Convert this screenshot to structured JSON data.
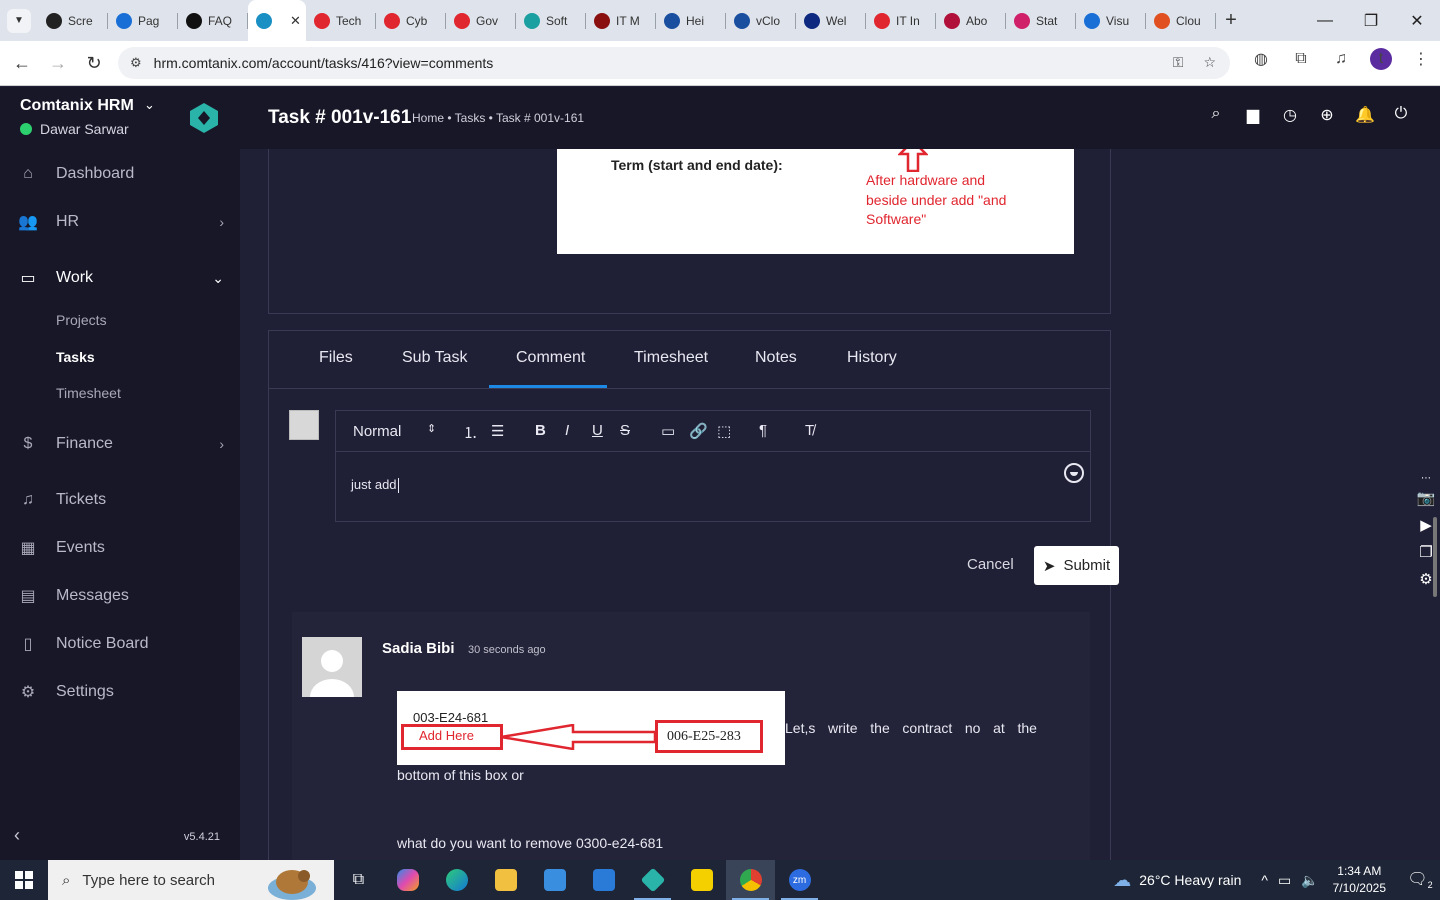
{
  "browser": {
    "tabs": [
      {
        "label": "Scre",
        "color": "#222222"
      },
      {
        "label": "Pag",
        "color": "#1a6fd6"
      },
      {
        "label": "FAQ",
        "color": "#111111"
      },
      {
        "label": "",
        "color": "#1a8fc4"
      },
      {
        "label": "Tech",
        "color": "#e0262f"
      },
      {
        "label": "Cyb",
        "color": "#e0262f"
      },
      {
        "label": "Gov",
        "color": "#e0262f"
      },
      {
        "label": "Soft",
        "color": "#1aa0a0"
      },
      {
        "label": "IT M",
        "color": "#8a1010"
      },
      {
        "label": "Hei",
        "color": "#1a4fa0"
      },
      {
        "label": "vClo",
        "color": "#1a4fa0"
      },
      {
        "label": "Wel",
        "color": "#0d2a80"
      },
      {
        "label": "IT In",
        "color": "#e0262f"
      },
      {
        "label": "Abo",
        "color": "#b0103a"
      },
      {
        "label": "Stat",
        "color": "#d0206a"
      },
      {
        "label": "Visu",
        "color": "#1a6fd6"
      },
      {
        "label": "Clou",
        "color": "#e05020"
      }
    ],
    "url": "hrm.comtanix.com/account/tasks/416?view=comments"
  },
  "sidebar": {
    "brand": "Comtanix HRM",
    "user": "Dawar Sarwar",
    "items": [
      {
        "label": "Dashboard",
        "icon": "home-icon"
      },
      {
        "label": "HR",
        "icon": "users-icon"
      },
      {
        "label": "Work",
        "icon": "briefcase-icon"
      },
      {
        "label": "Finance",
        "icon": "dollar-icon"
      },
      {
        "label": "Tickets",
        "icon": "headset-icon"
      },
      {
        "label": "Events",
        "icon": "calendar-icon"
      },
      {
        "label": "Messages",
        "icon": "message-icon"
      },
      {
        "label": "Notice Board",
        "icon": "clipboard-icon"
      },
      {
        "label": "Settings",
        "icon": "gear-icon"
      }
    ],
    "work_sub": [
      "Projects",
      "Tasks",
      "Timesheet"
    ],
    "version": "v5.4.21"
  },
  "header": {
    "title": "Task # 001v-161",
    "breadcrumb": "Home • Tasks • Task # 001v-161"
  },
  "attachment_preview": {
    "label": "Term (start and end date):",
    "note": "After hardware and beside under add \"and Software\""
  },
  "task_tabs": [
    "Files",
    "Sub Task",
    "Comment",
    "Timesheet",
    "Notes",
    "History"
  ],
  "active_tab": "Comment",
  "editor": {
    "format": "Normal",
    "content": "just add"
  },
  "actions": {
    "cancel": "Cancel",
    "submit": "Submit"
  },
  "comment": {
    "author": "Sadia Bibi",
    "time": "30 seconds ago",
    "image": {
      "old_no": "003-E24-681",
      "add_here": "Add Here",
      "new_no": "006-E25-283"
    },
    "text1_words": [
      "Let,s",
      "write",
      "the",
      "contract",
      "no",
      "at",
      "the"
    ],
    "text2": "bottom of this box or",
    "text3": "what do you want to remove 0300-e24-681"
  },
  "taskbar": {
    "search_placeholder": "Type here to search",
    "weather": "26°C  Heavy rain",
    "time": "1:34 AM",
    "date": "7/10/2025",
    "notifications": "2"
  }
}
